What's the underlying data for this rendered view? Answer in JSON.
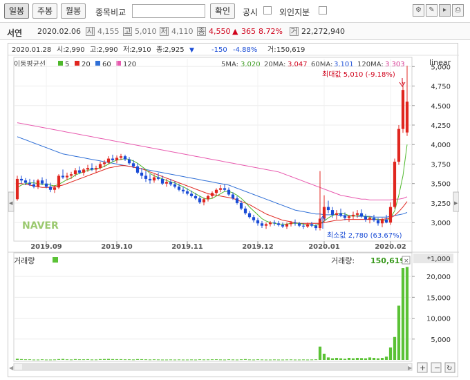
{
  "toolbar": {
    "tabs": [
      {
        "label": "일봉",
        "active": true
      },
      {
        "label": "주봉",
        "active": false
      },
      {
        "label": "월봉",
        "active": false
      }
    ],
    "compare_label": "종목비교",
    "compare_placeholder": "",
    "confirm_label": "확인",
    "disclosure_label": "공시",
    "foreign_label": "외인지분",
    "icons": [
      "settings-icon",
      "draw-icon",
      "cursor-icon",
      "print-icon"
    ]
  },
  "stock": {
    "name": "서연",
    "date": "2020.02.06",
    "open_tag": "시",
    "open": "4,155",
    "high_tag": "고",
    "high": "5,010",
    "low_tag": "저",
    "low": "4,110",
    "close_tag": "종",
    "close": "4,550",
    "change_arrow": "▲",
    "change": "365",
    "change_pct": "8.72%",
    "volume_tag": "거",
    "volume": "22,272,940"
  },
  "chart_header": {
    "date": "2020.01.28",
    "open_label": "시:",
    "open": "2,990",
    "high_label": "고:",
    "high": "2,990",
    "low_label": "저:",
    "low": "2,910",
    "close_label": "종:",
    "close": "2,925",
    "arrow": "▼",
    "change": "-150",
    "change_pct": "-4.88%",
    "volume_label": "거:",
    "volume": "150,619"
  },
  "ma_legend": {
    "title": "이동평균선",
    "items": [
      {
        "label": "5",
        "color": "#4fb82c"
      },
      {
        "label": "20",
        "color": "#e0261f"
      },
      {
        "label": "60",
        "color": "#2f6fd6"
      },
      {
        "label": "120",
        "color": "#e85aaf"
      }
    ]
  },
  "ma_values": [
    {
      "label": "5MA:",
      "value": "3,020",
      "color": "#3a9a1e"
    },
    {
      "label": "20MA:",
      "value": "3,047",
      "color": "#d0021b"
    },
    {
      "label": "60MA:",
      "value": "3,101",
      "color": "#1a4cd6"
    },
    {
      "label": "120MA:",
      "value": "3,303",
      "color": "#d4308e"
    }
  ],
  "scale_label": "linear",
  "max_annotation": "최대값 5,010 (-9.18%)",
  "min_annotation": "최소값 2,780 (63.67%)",
  "watermark": "NAVER",
  "volume_panel": {
    "title": "거래량",
    "legend_color": "#5bc236",
    "value_label": "거래량:",
    "value": "150,619",
    "unit": "*1,000"
  },
  "chart_data": {
    "type": "candlestick",
    "price_axis": {
      "ticks": [
        3000,
        3250,
        3500,
        3750,
        4000,
        4250,
        4500,
        4750,
        5000
      ],
      "range": [
        2780,
        5100
      ],
      "scale": "linear"
    },
    "x_tick_labels": [
      "2019.09",
      "2019.10",
      "2019.11",
      "2019.12",
      "2020.01",
      "2020.02"
    ],
    "volume_axis": {
      "ticks": [
        5000,
        10000,
        15000,
        20000
      ],
      "range": [
        0,
        22500
      ],
      "unit": "*1,000"
    },
    "candles": [
      [
        3300,
        3600,
        3280,
        3560
      ],
      [
        3560,
        3600,
        3500,
        3540
      ],
      [
        3540,
        3570,
        3480,
        3510
      ],
      [
        3510,
        3560,
        3470,
        3490
      ],
      [
        3490,
        3550,
        3440,
        3460
      ],
      [
        3460,
        3560,
        3430,
        3540
      ],
      [
        3540,
        3580,
        3480,
        3500
      ],
      [
        3500,
        3560,
        3440,
        3460
      ],
      [
        3460,
        3510,
        3390,
        3420
      ],
      [
        3420,
        3480,
        3380,
        3450
      ],
      [
        3450,
        3620,
        3430,
        3600
      ],
      [
        3600,
        3680,
        3560,
        3580
      ],
      [
        3580,
        3640,
        3540,
        3600
      ],
      [
        3600,
        3650,
        3560,
        3620
      ],
      [
        3620,
        3700,
        3590,
        3670
      ],
      [
        3670,
        3720,
        3620,
        3640
      ],
      [
        3640,
        3700,
        3600,
        3680
      ],
      [
        3680,
        3740,
        3650,
        3700
      ],
      [
        3700,
        3760,
        3660,
        3680
      ],
      [
        3680,
        3730,
        3640,
        3700
      ],
      [
        3700,
        3780,
        3680,
        3750
      ],
      [
        3750,
        3800,
        3710,
        3770
      ],
      [
        3770,
        3850,
        3750,
        3820
      ],
      [
        3820,
        3870,
        3780,
        3800
      ],
      [
        3800,
        3860,
        3760,
        3830
      ],
      [
        3830,
        3880,
        3800,
        3850
      ],
      [
        3850,
        3870,
        3790,
        3810
      ],
      [
        3810,
        3840,
        3740,
        3760
      ],
      [
        3760,
        3800,
        3700,
        3720
      ],
      [
        3720,
        3760,
        3620,
        3640
      ],
      [
        3640,
        3700,
        3560,
        3600
      ],
      [
        3600,
        3660,
        3520,
        3560
      ],
      [
        3560,
        3620,
        3500,
        3540
      ],
      [
        3540,
        3620,
        3510,
        3580
      ],
      [
        3580,
        3640,
        3540,
        3560
      ],
      [
        3560,
        3600,
        3480,
        3500
      ],
      [
        3500,
        3560,
        3460,
        3520
      ],
      [
        3520,
        3560,
        3470,
        3490
      ],
      [
        3490,
        3530,
        3440,
        3460
      ],
      [
        3460,
        3500,
        3400,
        3420
      ],
      [
        3420,
        3460,
        3370,
        3400
      ],
      [
        3400,
        3440,
        3350,
        3370
      ],
      [
        3370,
        3410,
        3320,
        3340
      ],
      [
        3340,
        3380,
        3290,
        3310
      ],
      [
        3310,
        3340,
        3240,
        3260
      ],
      [
        3260,
        3320,
        3220,
        3300
      ],
      [
        3300,
        3360,
        3270,
        3340
      ],
      [
        3340,
        3400,
        3310,
        3380
      ],
      [
        3380,
        3440,
        3350,
        3420
      ],
      [
        3420,
        3480,
        3390,
        3440
      ],
      [
        3440,
        3490,
        3400,
        3420
      ],
      [
        3420,
        3450,
        3340,
        3360
      ],
      [
        3360,
        3390,
        3290,
        3310
      ],
      [
        3310,
        3340,
        3230,
        3250
      ],
      [
        3250,
        3280,
        3160,
        3180
      ],
      [
        3180,
        3210,
        3100,
        3120
      ],
      [
        3120,
        3150,
        3050,
        3070
      ],
      [
        3070,
        3100,
        3000,
        3030
      ],
      [
        3030,
        3060,
        2960,
        2990
      ],
      [
        2990,
        3020,
        2930,
        2960
      ],
      [
        2960,
        3000,
        2920,
        2980
      ],
      [
        2980,
        3020,
        2950,
        3000
      ],
      [
        3000,
        3030,
        2960,
        2990
      ],
      [
        2990,
        3020,
        2950,
        2970
      ],
      [
        2970,
        3000,
        2930,
        2950
      ],
      [
        2950,
        3000,
        2920,
        2980
      ],
      [
        2980,
        3020,
        2950,
        3000
      ],
      [
        3000,
        3040,
        2960,
        2990
      ],
      [
        2990,
        3010,
        2940,
        2960
      ],
      [
        2960,
        2990,
        2920,
        2950
      ],
      [
        2950,
        3000,
        2930,
        2980
      ],
      [
        2980,
        3010,
        2940,
        2960
      ],
      [
        2960,
        2980,
        2900,
        2930
      ],
      [
        2930,
        3660,
        2900,
        3050
      ],
      [
        3050,
        3350,
        3000,
        3200
      ],
      [
        3200,
        3280,
        3120,
        3160
      ],
      [
        3160,
        3200,
        3060,
        3100
      ],
      [
        3100,
        3160,
        3040,
        3120
      ],
      [
        3120,
        3180,
        3070,
        3090
      ],
      [
        3090,
        3130,
        3030,
        3060
      ],
      [
        3060,
        3100,
        3010,
        3080
      ],
      [
        3080,
        3140,
        3040,
        3100
      ],
      [
        3100,
        3160,
        3060,
        3120
      ],
      [
        3120,
        3170,
        3060,
        3080
      ],
      [
        3080,
        3110,
        3010,
        3040
      ],
      [
        3040,
        3080,
        2990,
        3060
      ],
      [
        3060,
        3100,
        3010,
        3030
      ],
      [
        3030,
        3060,
        2960,
        2990
      ],
      [
        2990,
        3060,
        2940,
        3040
      ],
      [
        3040,
        3100,
        2990,
        3000
      ],
      [
        3000,
        3260,
        2970,
        3200
      ],
      [
        3200,
        3820,
        3180,
        3780
      ],
      [
        3780,
        4250,
        3740,
        4200
      ],
      [
        4200,
        4800,
        4150,
        4700
      ],
      [
        4155,
        5010,
        4110,
        4550
      ]
    ],
    "ma5": [
      3450,
      3480,
      3500,
      3510,
      3510,
      3500,
      3490,
      3490,
      3480,
      3470,
      3490,
      3520,
      3550,
      3570,
      3610,
      3630,
      3650,
      3670,
      3680,
      3690,
      3700,
      3720,
      3750,
      3780,
      3800,
      3810,
      3820,
      3810,
      3790,
      3760,
      3720,
      3680,
      3630,
      3600,
      3580,
      3560,
      3540,
      3520,
      3510,
      3480,
      3460,
      3430,
      3400,
      3370,
      3340,
      3310,
      3300,
      3310,
      3340,
      3370,
      3400,
      3400,
      3380,
      3350,
      3310,
      3260,
      3200,
      3150,
      3100,
      3050,
      3020,
      3000,
      2990,
      2980,
      2980,
      2980,
      2990,
      2990,
      2990,
      2980,
      2970,
      2970,
      2960,
      2990,
      3020,
      3060,
      3090,
      3110,
      3120,
      3110,
      3090,
      3080,
      3090,
      3090,
      3080,
      3070,
      3050,
      3040,
      3030,
      3030,
      3060,
      3150,
      3350,
      3600,
      4000
    ],
    "ma20": [
      3500,
      3500,
      3490,
      3480,
      3470,
      3460,
      3450,
      3450,
      3450,
      3460,
      3470,
      3480,
      3500,
      3520,
      3540,
      3560,
      3580,
      3600,
      3620,
      3640,
      3660,
      3680,
      3700,
      3710,
      3720,
      3730,
      3730,
      3720,
      3710,
      3700,
      3690,
      3670,
      3650,
      3630,
      3610,
      3590,
      3570,
      3550,
      3530,
      3510,
      3490,
      3470,
      3450,
      3430,
      3410,
      3390,
      3370,
      3360,
      3350,
      3340,
      3330,
      3320,
      3310,
      3290,
      3270,
      3250,
      3230,
      3200,
      3170,
      3140,
      3110,
      3090,
      3070,
      3050,
      3030,
      3020,
      3010,
      3000,
      2990,
      2990,
      2990,
      2990,
      2990,
      2990,
      3000,
      3010,
      3020,
      3030,
      3030,
      3040,
      3040,
      3040,
      3040,
      3040,
      3040,
      3040,
      3040,
      3040,
      3040,
      3050,
      3060,
      3090,
      3140,
      3200,
      3270
    ],
    "ma60": [
      4100,
      4080,
      4060,
      4040,
      4020,
      4000,
      3980,
      3960,
      3940,
      3920,
      3900,
      3880,
      3870,
      3860,
      3850,
      3840,
      3830,
      3820,
      3810,
      3800,
      3790,
      3780,
      3770,
      3760,
      3750,
      3740,
      3730,
      3720,
      3710,
      3700,
      3690,
      3680,
      3670,
      3660,
      3650,
      3640,
      3630,
      3620,
      3610,
      3600,
      3590,
      3580,
      3570,
      3560,
      3550,
      3540,
      3530,
      3520,
      3510,
      3500,
      3490,
      3480,
      3460,
      3440,
      3420,
      3400,
      3380,
      3360,
      3340,
      3320,
      3300,
      3280,
      3260,
      3240,
      3220,
      3200,
      3180,
      3160,
      3150,
      3140,
      3130,
      3120,
      3110,
      3110,
      3100,
      3100,
      3100,
      3100,
      3090,
      3090,
      3090,
      3090,
      3080,
      3080,
      3080,
      3080,
      3070,
      3070,
      3070,
      3070,
      3080,
      3090,
      3100,
      3110,
      3130
    ],
    "ma120": [
      4280,
      4270,
      4260,
      4250,
      4240,
      4230,
      4220,
      4210,
      4200,
      4190,
      4180,
      4170,
      4160,
      4150,
      4140,
      4130,
      4120,
      4110,
      4100,
      4090,
      4080,
      4070,
      4060,
      4050,
      4040,
      4030,
      4020,
      4010,
      4000,
      3990,
      3980,
      3970,
      3960,
      3950,
      3940,
      3930,
      3920,
      3910,
      3900,
      3890,
      3880,
      3870,
      3860,
      3850,
      3840,
      3830,
      3820,
      3810,
      3800,
      3790,
      3780,
      3770,
      3760,
      3750,
      3740,
      3730,
      3720,
      3710,
      3700,
      3690,
      3680,
      3670,
      3660,
      3650,
      3630,
      3610,
      3590,
      3570,
      3550,
      3530,
      3510,
      3490,
      3470,
      3450,
      3430,
      3410,
      3390,
      3370,
      3350,
      3340,
      3330,
      3320,
      3310,
      3300,
      3300,
      3290,
      3290,
      3290,
      3290,
      3290,
      3290,
      3300,
      3300,
      3310,
      3330
    ],
    "volumes": [
      300,
      200,
      150,
      150,
      100,
      100,
      150,
      100,
      100,
      120,
      200,
      250,
      150,
      120,
      200,
      150,
      150,
      180,
      120,
      120,
      200,
      220,
      250,
      200,
      180,
      180,
      150,
      150,
      120,
      200,
      180,
      150,
      120,
      150,
      120,
      100,
      100,
      120,
      100,
      120,
      100,
      100,
      120,
      100,
      150,
      120,
      130,
      150,
      160,
      120,
      100,
      150,
      120,
      100,
      150,
      200,
      120,
      100,
      150,
      120,
      100,
      100,
      120,
      100,
      100,
      120,
      130,
      100,
      100,
      120,
      100,
      120,
      150,
      3200,
      1500,
      600,
      400,
      500,
      400,
      300,
      500,
      400,
      500,
      450,
      400,
      600,
      500,
      400,
      500,
      800,
      3000,
      5500,
      13000,
      22000,
      22273
    ]
  }
}
